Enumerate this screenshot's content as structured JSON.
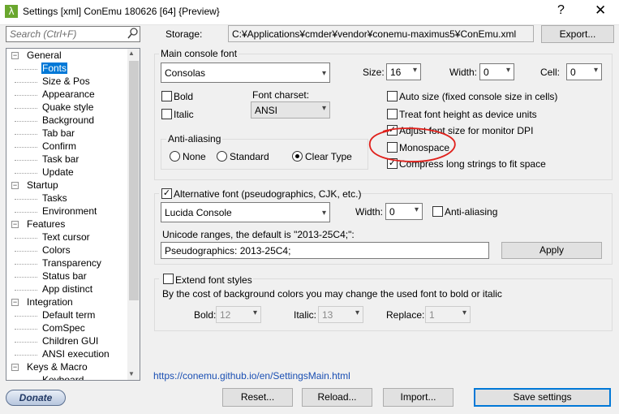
{
  "window": {
    "title": "Settings [xml] ConEmu 180626 [64] {Preview}",
    "help": "?",
    "close": "✕",
    "app_icon": "λ"
  },
  "search": {
    "placeholder": "Search (Ctrl+F)"
  },
  "storage": {
    "label": "Storage:",
    "value": "C:¥Applications¥cmder¥vendor¥conemu-maximus5¥ConEmu.xml",
    "export_label": "Export..."
  },
  "tree": [
    {
      "label": "General",
      "level": 0,
      "expander": "−"
    },
    {
      "label": "Fonts",
      "level": 1,
      "selected": true
    },
    {
      "label": "Size & Pos",
      "level": 1
    },
    {
      "label": "Appearance",
      "level": 1
    },
    {
      "label": "Quake style",
      "level": 1
    },
    {
      "label": "Background",
      "level": 1
    },
    {
      "label": "Tab bar",
      "level": 1
    },
    {
      "label": "Confirm",
      "level": 1
    },
    {
      "label": "Task bar",
      "level": 1
    },
    {
      "label": "Update",
      "level": 1
    },
    {
      "label": "Startup",
      "level": 0,
      "expander": "−"
    },
    {
      "label": "Tasks",
      "level": 1
    },
    {
      "label": "Environment",
      "level": 1
    },
    {
      "label": "Features",
      "level": 0,
      "expander": "−"
    },
    {
      "label": "Text cursor",
      "level": 1
    },
    {
      "label": "Colors",
      "level": 1
    },
    {
      "label": "Transparency",
      "level": 1
    },
    {
      "label": "Status bar",
      "level": 1
    },
    {
      "label": "App distinct",
      "level": 1
    },
    {
      "label": "Integration",
      "level": 0,
      "expander": "−"
    },
    {
      "label": "Default term",
      "level": 1
    },
    {
      "label": "ComSpec",
      "level": 1
    },
    {
      "label": "Children GUI",
      "level": 1
    },
    {
      "label": "ANSI execution",
      "level": 1
    },
    {
      "label": "Keys & Macro",
      "level": 0,
      "expander": "−"
    },
    {
      "label": "Keyboard",
      "level": 1
    }
  ],
  "main_font": {
    "group_title": "Main console font",
    "font_value": "Consolas",
    "size_label": "Size:",
    "size_value": "16",
    "width_label": "Width:",
    "width_value": "0",
    "cell_label": "Cell:",
    "cell_value": "0",
    "bold": "Bold",
    "italic": "Italic",
    "charset_label": "Font charset:",
    "charset_value": "ANSI",
    "aa_title": "Anti-aliasing",
    "aa_none": "None",
    "aa_standard": "Standard",
    "aa_cleartype": "Clear Type",
    "auto_size": "Auto size (fixed console size in cells)",
    "treat_height": "Treat font height as device units",
    "adjust_dpi": "Adjust font size for monitor DPI",
    "monospace": "Monospace",
    "compress": "Compress long strings to fit space"
  },
  "alt_font": {
    "title": "Alternative font (pseudographics, CJK, etc.)",
    "font_value": "Lucida Console",
    "width_label": "Width:",
    "width_value": "0",
    "aa_label": "Anti-aliasing",
    "ranges_label": "Unicode ranges, the default is \"2013-25C4;\":",
    "ranges_value": "Pseudographics: 2013-25C4;",
    "apply_label": "Apply"
  },
  "extend": {
    "title": "Extend font styles",
    "description": "By the cost of background colors you may change the used font to bold or italic",
    "bold_label": "Bold:",
    "bold_value": "12",
    "italic_label": "Italic:",
    "italic_value": "13",
    "replace_label": "Replace:",
    "replace_value": "1"
  },
  "footer": {
    "link": "https://conemu.github.io/en/SettingsMain.html",
    "donate": "Donate",
    "reset": "Reset...",
    "reload": "Reload...",
    "import": "Import...",
    "save": "Save settings"
  },
  "checks": {
    "checked": "✓"
  },
  "colors": {
    "selection": "#0078d7",
    "annotation": "#e0201b",
    "link": "#1a4fb3"
  }
}
